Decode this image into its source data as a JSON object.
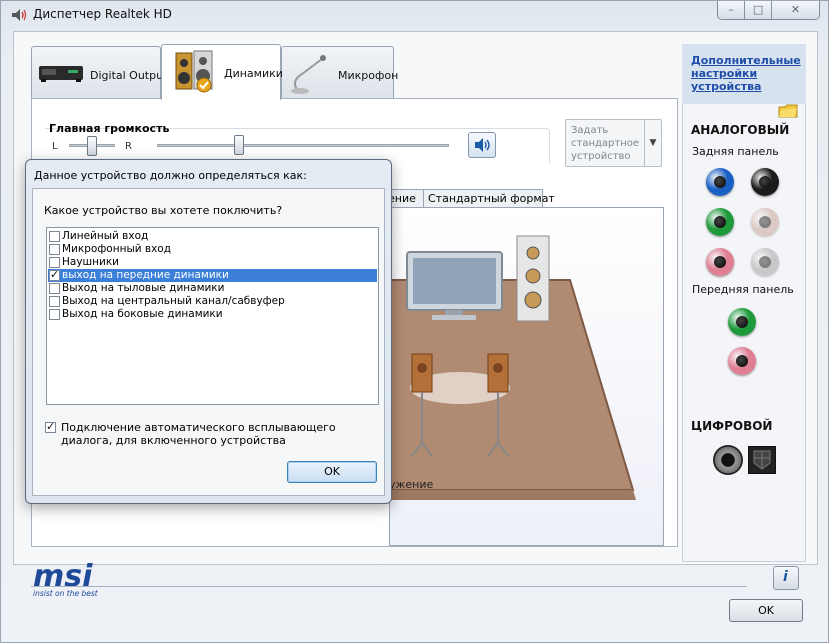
{
  "window": {
    "title": "Диспетчер Realtek HD",
    "minimize_glyph": "–",
    "maximize_glyph": "□",
    "close_glyph": "✕"
  },
  "tabs": [
    {
      "label": "Digital Output",
      "icon": "receiver-device-icon"
    },
    {
      "label": "Динамики",
      "icon": "speakers-icon",
      "active": true
    },
    {
      "label": "Микрофон",
      "icon": "microphone-icon"
    }
  ],
  "volume": {
    "title": "Главная громкость",
    "left_label": "L",
    "right_label": "R",
    "balance_fraction": 0.5,
    "level_fraction": 0.28
  },
  "default_device": {
    "label": "Задать стандартное устройство",
    "arrow": "▼"
  },
  "subtabs": {
    "partial_label": "ение",
    "format_label": "Стандартный формат"
  },
  "room": {
    "caption_partial": "ужение"
  },
  "right_panel": {
    "advanced_link": "Дополнительные настройки устройства",
    "analog_title": "АНАЛОГОВЫЙ",
    "rear_panel": "Задняя панель",
    "front_panel": "Передняя панель",
    "digital_title": "ЦИФРОВОЙ",
    "colors": {
      "blue": "#1a5fc4",
      "black": "#1b1b1b",
      "green": "#1f9a3b",
      "tan": "#c9a89a",
      "pink": "#e07f94",
      "gray": "#a5a5a5"
    }
  },
  "brand": {
    "logo": "msi",
    "tagline": "insist on the best"
  },
  "info_button": "i",
  "ok_button": "OK",
  "dialog": {
    "title": "Данное устройство должно определяться как:",
    "question": "Какое устройство вы хотете поключить?",
    "options": [
      {
        "label": "Линейный вход",
        "checked": false,
        "selected": false
      },
      {
        "label": "Микрофонный вход",
        "checked": false,
        "selected": false
      },
      {
        "label": "Наушники",
        "checked": false,
        "selected": false
      },
      {
        "label": "выход на передние динамики",
        "checked": true,
        "selected": true
      },
      {
        "label": "Выход на тыловые динамики",
        "checked": false,
        "selected": false
      },
      {
        "label": "Выход на центральный канал/сабвуфер",
        "checked": false,
        "selected": false
      },
      {
        "label": "Выход на боковые динамики",
        "checked": false,
        "selected": false
      }
    ],
    "auto_popup_label": "Подключение автоматического всплывающего диалога, для включенного устройства",
    "auto_popup_checked": true,
    "ok_label": "OK"
  }
}
